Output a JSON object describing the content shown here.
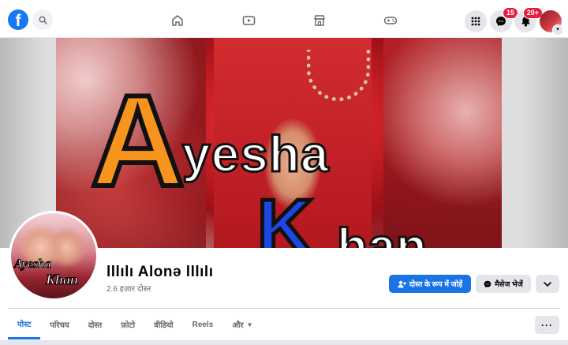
{
  "topbar": {
    "messenger_badge": "15",
    "notifications_badge": "20+"
  },
  "cover": {
    "line1_letter": "A",
    "line1_rest": "yesha",
    "line2_letter": "K",
    "line2_rest": "han"
  },
  "profile_pic": {
    "text_line1": "Ayesha",
    "text_line2": "Khan"
  },
  "profile": {
    "name": "lllılı Alonə lllılı",
    "friends": "2.6 हज़ार दोस्त"
  },
  "actions": {
    "add_friend": "दोस्त के रूप में जोड़ें",
    "message": "मैसेज भेजें"
  },
  "tabs": [
    {
      "label": "पोस्ट"
    },
    {
      "label": "परिचय"
    },
    {
      "label": "दोस्त"
    },
    {
      "label": "फ़ोटो"
    },
    {
      "label": "वीडियो"
    },
    {
      "label": "Reels"
    },
    {
      "label": "और"
    }
  ],
  "colors": {
    "accent": "#1b74e4",
    "badge": "#e41e3f"
  }
}
